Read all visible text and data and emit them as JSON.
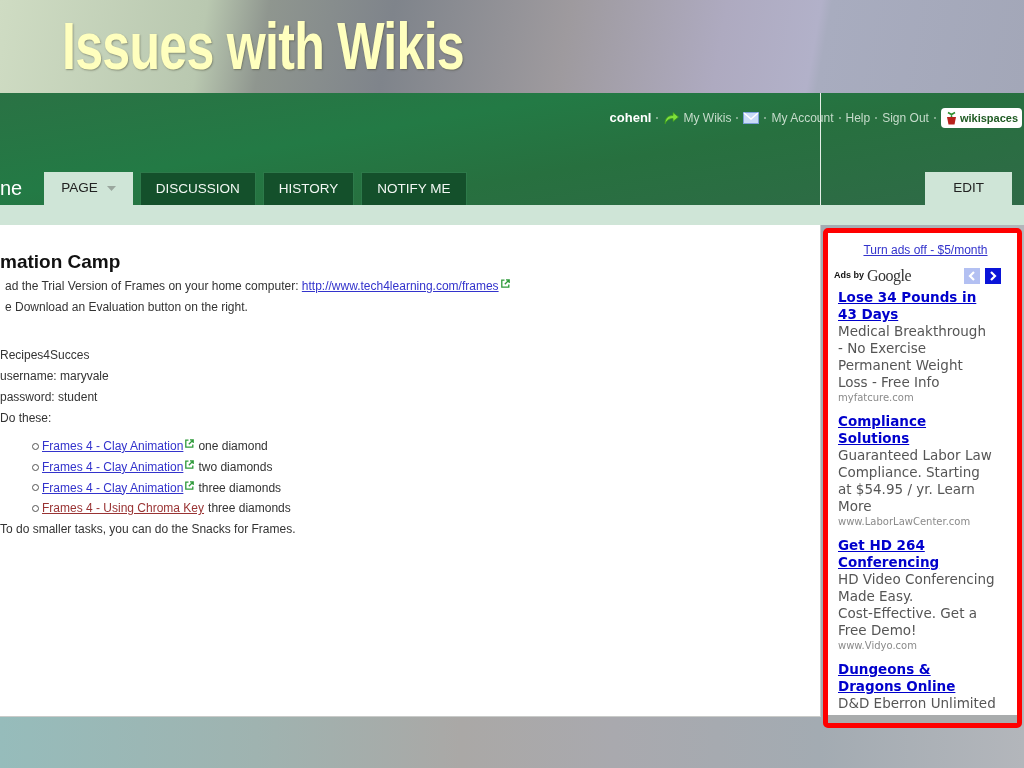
{
  "slide": {
    "title": "Issues with Wikis"
  },
  "user_bar": [
    {
      "kind": "user",
      "label": "cohenl"
    },
    {
      "kind": "wikis",
      "label": "My Wikis"
    },
    {
      "kind": "inbox"
    },
    {
      "kind": "link",
      "label": "My Account"
    },
    {
      "kind": "link",
      "label": "Help"
    },
    {
      "kind": "link",
      "label": "Sign Out"
    },
    {
      "kind": "logo",
      "label": "wikispaces"
    }
  ],
  "tabs": {
    "page_name": "ne",
    "items": [
      {
        "label": "PAGE",
        "selected": true,
        "dropdown": true
      },
      {
        "label": "DISCUSSION",
        "selected": false,
        "dropdown": false
      },
      {
        "label": "HISTORY",
        "selected": false,
        "dropdown": false
      },
      {
        "label": "NOTIFY ME",
        "selected": false,
        "dropdown": false
      }
    ],
    "edit_button": "EDIT"
  },
  "content": {
    "heading": "mation Camp",
    "paragraphs": [
      {
        "text": "ad the Trial Version of Frames on your home computer:",
        "link": {
          "label": "http://www.tech4learning.com/frames",
          "external": true,
          "visited": false
        }
      },
      {
        "text": "e Download an Evaluation button on the right."
      }
    ],
    "lines": [
      "Recipes4Succes",
      "username: maryvale",
      "password: student",
      "Do these:"
    ],
    "tasks": [
      {
        "link": {
          "label": "Frames 4 - Clay Animation",
          "external": true,
          "visited": false
        },
        "note": "one diamond"
      },
      {
        "link": {
          "label": "Frames 4 - Clay Animation",
          "external": true,
          "visited": false
        },
        "note": "two diamonds"
      },
      {
        "link": {
          "label": "Frames 4 - Clay Animation",
          "external": true,
          "visited": false
        },
        "note": "three diamonds"
      },
      {
        "link": {
          "label": "Frames 4 - Using Chroma Key",
          "external": false,
          "visited": true
        },
        "note": "three diamonds"
      }
    ],
    "footer": "To do smaller tasks, you can do the Snacks for Frames."
  },
  "ads": {
    "turn_off_link": "Turn ads off - $5/month",
    "ads_by": "Ads by",
    "brand": "Google",
    "nav": [
      {
        "kind": "prev",
        "disabled": true
      },
      {
        "kind": "next",
        "disabled": false
      }
    ],
    "items": [
      {
        "title_lines": [
          "Lose 34 Pounds in",
          "43 Days"
        ],
        "text_lines": [
          "Medical Breakthrough",
          "- No Exercise",
          "Permanent Weight",
          "Loss - Free Info"
        ],
        "url": "myfatcure.com"
      },
      {
        "title_lines": [
          "Compliance",
          "Solutions"
        ],
        "text_lines": [
          "Guaranteed Labor Law",
          "Compliance. Starting",
          "at $54.95 / yr. Learn",
          "More"
        ],
        "url": "www.LaborLawCenter.com"
      },
      {
        "title_lines": [
          "Get HD 264",
          "Conferencing"
        ],
        "text_lines": [
          "HD Video Conferencing",
          "Made Easy.",
          "Cost-Effective. Get a",
          "Free Demo!"
        ],
        "url": "www.Vidyo.com"
      },
      {
        "title_lines": [
          "Dungeons &",
          "Dragons Online"
        ],
        "text_lines": [
          "D&D Eberron Unlimited"
        ]
      }
    ]
  }
}
